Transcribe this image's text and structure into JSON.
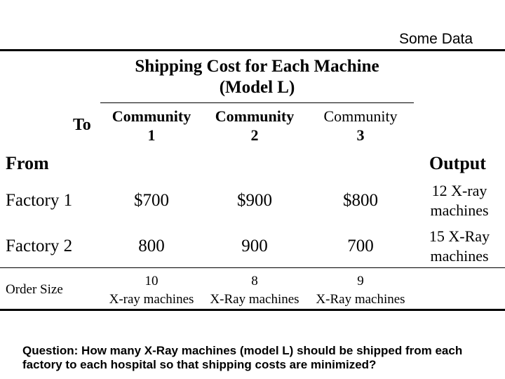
{
  "slide_label": "Some Data",
  "title": {
    "line1": "Shipping Cost for Each Machine",
    "line2": "(Model L)"
  },
  "table": {
    "to_label": "To",
    "from_label": "From",
    "output_label": "Output",
    "columns": [
      {
        "name": "Community",
        "number": "1"
      },
      {
        "name": "Community",
        "number": "2"
      },
      {
        "name": "Community",
        "number": "3"
      }
    ],
    "rows": [
      {
        "label": "Factory 1",
        "costs": [
          "$700",
          "$900",
          "$800"
        ],
        "output_line1": "12 X-ray",
        "output_line2": "machines"
      },
      {
        "label": "Factory 2",
        "costs": [
          "800",
          "900",
          "700"
        ],
        "output_line1": "15 X-Ray",
        "output_line2": "machines"
      }
    ],
    "order_size": {
      "label": "Order Size",
      "values": [
        {
          "qty": "10",
          "unit": "X-ray machines"
        },
        {
          "qty": "8",
          "unit": "X-Ray machines"
        },
        {
          "qty": "9",
          "unit": "X-Ray machines"
        }
      ]
    }
  },
  "question": "Question: How many X-Ray machines (model L) should be shipped from each factory to each hospital so that shipping costs are minimized?"
}
